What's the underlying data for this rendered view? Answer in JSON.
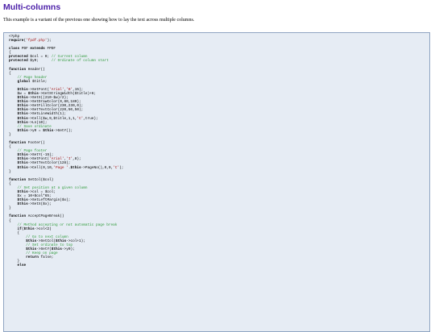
{
  "page": {
    "title": "Multi-columns",
    "intro": "This example is a variant of the previous one showing how to lay the text across multiple columns."
  },
  "code": [
    [
      {
        "t": "<?php",
        "k": "plain"
      }
    ],
    [
      {
        "t": "require",
        "k": "kw"
      },
      {
        "t": "(",
        "k": "plain"
      },
      {
        "t": "'fpdf.php'",
        "k": "str"
      },
      {
        "t": ");",
        "k": "plain"
      }
    ],
    [
      {
        "t": "",
        "k": "plain"
      }
    ],
    [
      {
        "t": "class",
        "k": "kw"
      },
      {
        "t": " PDF ",
        "k": "plain"
      },
      {
        "t": "extends",
        "k": "kw"
      },
      {
        "t": " FPDF",
        "k": "plain"
      }
    ],
    [
      {
        "t": "{",
        "k": "plain"
      }
    ],
    [
      {
        "t": "protected",
        "k": "kw"
      },
      {
        "t": " $col = 0; ",
        "k": "plain"
      },
      {
        "t": "// Current column",
        "k": "cmt"
      }
    ],
    [
      {
        "t": "protected",
        "k": "kw"
      },
      {
        "t": " $y0;      ",
        "k": "plain"
      },
      {
        "t": "// Ordinate of column start",
        "k": "cmt"
      }
    ],
    [
      {
        "t": "",
        "k": "plain"
      }
    ],
    [
      {
        "t": "function",
        "k": "kw"
      },
      {
        "t": " Header()",
        "k": "plain"
      }
    ],
    [
      {
        "t": "{",
        "k": "plain"
      }
    ],
    [
      {
        "t": "    ",
        "k": "plain"
      },
      {
        "t": "// Page header",
        "k": "cmt"
      }
    ],
    [
      {
        "t": "    ",
        "k": "plain"
      },
      {
        "t": "global",
        "k": "kw"
      },
      {
        "t": " $title;",
        "k": "plain"
      }
    ],
    [
      {
        "t": "",
        "k": "plain"
      }
    ],
    [
      {
        "t": "    ",
        "k": "plain"
      },
      {
        "t": "$this",
        "k": "kw"
      },
      {
        "t": "->SetFont(",
        "k": "plain"
      },
      {
        "t": "'Arial'",
        "k": "str"
      },
      {
        "t": ",",
        "k": "plain"
      },
      {
        "t": "'B'",
        "k": "str"
      },
      {
        "t": ",15);",
        "k": "plain"
      }
    ],
    [
      {
        "t": "    $w = ",
        "k": "plain"
      },
      {
        "t": "$this",
        "k": "kw"
      },
      {
        "t": "->GetStringWidth($title)+6;",
        "k": "plain"
      }
    ],
    [
      {
        "t": "    ",
        "k": "plain"
      },
      {
        "t": "$this",
        "k": "kw"
      },
      {
        "t": "->SetX((210-$w)/2);",
        "k": "plain"
      }
    ],
    [
      {
        "t": "    ",
        "k": "plain"
      },
      {
        "t": "$this",
        "k": "kw"
      },
      {
        "t": "->SetDrawColor(0,80,180);",
        "k": "plain"
      }
    ],
    [
      {
        "t": "    ",
        "k": "plain"
      },
      {
        "t": "$this",
        "k": "kw"
      },
      {
        "t": "->SetFillColor(230,230,0);",
        "k": "plain"
      }
    ],
    [
      {
        "t": "    ",
        "k": "plain"
      },
      {
        "t": "$this",
        "k": "kw"
      },
      {
        "t": "->SetTextColor(220,50,50);",
        "k": "plain"
      }
    ],
    [
      {
        "t": "    ",
        "k": "plain"
      },
      {
        "t": "$this",
        "k": "kw"
      },
      {
        "t": "->SetLineWidth(1);",
        "k": "plain"
      }
    ],
    [
      {
        "t": "    ",
        "k": "plain"
      },
      {
        "t": "$this",
        "k": "kw"
      },
      {
        "t": "->Cell($w,9,$title,1,1,",
        "k": "plain"
      },
      {
        "t": "'C'",
        "k": "str"
      },
      {
        "t": ",true);",
        "k": "plain"
      }
    ],
    [
      {
        "t": "    ",
        "k": "plain"
      },
      {
        "t": "$this",
        "k": "kw"
      },
      {
        "t": "->Ln(10);",
        "k": "plain"
      }
    ],
    [
      {
        "t": "    ",
        "k": "plain"
      },
      {
        "t": "// Save ordinate",
        "k": "cmt"
      }
    ],
    [
      {
        "t": "    ",
        "k": "plain"
      },
      {
        "t": "$this",
        "k": "kw"
      },
      {
        "t": "->y0 = ",
        "k": "plain"
      },
      {
        "t": "$this",
        "k": "kw"
      },
      {
        "t": "->GetY();",
        "k": "plain"
      }
    ],
    [
      {
        "t": "}",
        "k": "plain"
      }
    ],
    [
      {
        "t": "",
        "k": "plain"
      }
    ],
    [
      {
        "t": "function",
        "k": "kw"
      },
      {
        "t": " Footer()",
        "k": "plain"
      }
    ],
    [
      {
        "t": "{",
        "k": "plain"
      }
    ],
    [
      {
        "t": "    ",
        "k": "plain"
      },
      {
        "t": "// Page footer",
        "k": "cmt"
      }
    ],
    [
      {
        "t": "    ",
        "k": "plain"
      },
      {
        "t": "$this",
        "k": "kw"
      },
      {
        "t": "->SetY(-15);",
        "k": "plain"
      }
    ],
    [
      {
        "t": "    ",
        "k": "plain"
      },
      {
        "t": "$this",
        "k": "kw"
      },
      {
        "t": "->SetFont(",
        "k": "plain"
      },
      {
        "t": "'Arial'",
        "k": "str"
      },
      {
        "t": ",",
        "k": "plain"
      },
      {
        "t": "'I'",
        "k": "str"
      },
      {
        "t": ",8);",
        "k": "plain"
      }
    ],
    [
      {
        "t": "    ",
        "k": "plain"
      },
      {
        "t": "$this",
        "k": "kw"
      },
      {
        "t": "->SetTextColor(128);",
        "k": "plain"
      }
    ],
    [
      {
        "t": "    ",
        "k": "plain"
      },
      {
        "t": "$this",
        "k": "kw"
      },
      {
        "t": "->Cell(0,10,",
        "k": "plain"
      },
      {
        "t": "'Page '",
        "k": "str"
      },
      {
        "t": ".",
        "k": "plain"
      },
      {
        "t": "$this",
        "k": "kw"
      },
      {
        "t": "->PageNo(),0,0,",
        "k": "plain"
      },
      {
        "t": "'C'",
        "k": "str"
      },
      {
        "t": ");",
        "k": "plain"
      }
    ],
    [
      {
        "t": "}",
        "k": "plain"
      }
    ],
    [
      {
        "t": "",
        "k": "plain"
      }
    ],
    [
      {
        "t": "function",
        "k": "kw"
      },
      {
        "t": " SetCol($col)",
        "k": "plain"
      }
    ],
    [
      {
        "t": "{",
        "k": "plain"
      }
    ],
    [
      {
        "t": "    ",
        "k": "plain"
      },
      {
        "t": "// Set position at a given column",
        "k": "cmt"
      }
    ],
    [
      {
        "t": "    ",
        "k": "plain"
      },
      {
        "t": "$this",
        "k": "kw"
      },
      {
        "t": "->col = $col;",
        "k": "plain"
      }
    ],
    [
      {
        "t": "    $x = 10+$col*65;",
        "k": "plain"
      }
    ],
    [
      {
        "t": "    ",
        "k": "plain"
      },
      {
        "t": "$this",
        "k": "kw"
      },
      {
        "t": "->SetLeftMargin($x);",
        "k": "plain"
      }
    ],
    [
      {
        "t": "    ",
        "k": "plain"
      },
      {
        "t": "$this",
        "k": "kw"
      },
      {
        "t": "->SetX($x);",
        "k": "plain"
      }
    ],
    [
      {
        "t": "}",
        "k": "plain"
      }
    ],
    [
      {
        "t": "",
        "k": "plain"
      }
    ],
    [
      {
        "t": "function",
        "k": "kw"
      },
      {
        "t": " AcceptPageBreak()",
        "k": "plain"
      }
    ],
    [
      {
        "t": "{",
        "k": "plain"
      }
    ],
    [
      {
        "t": "    ",
        "k": "plain"
      },
      {
        "t": "// Method accepting or not automatic page break",
        "k": "cmt"
      }
    ],
    [
      {
        "t": "    ",
        "k": "plain"
      },
      {
        "t": "if",
        "k": "kw"
      },
      {
        "t": "(",
        "k": "plain"
      },
      {
        "t": "$this",
        "k": "kw"
      },
      {
        "t": "->col<2)",
        "k": "plain"
      }
    ],
    [
      {
        "t": "    {",
        "k": "plain"
      }
    ],
    [
      {
        "t": "        ",
        "k": "plain"
      },
      {
        "t": "// Go to next column",
        "k": "cmt"
      }
    ],
    [
      {
        "t": "        ",
        "k": "plain"
      },
      {
        "t": "$this",
        "k": "kw"
      },
      {
        "t": "->SetCol(",
        "k": "plain"
      },
      {
        "t": "$this",
        "k": "kw"
      },
      {
        "t": "->col+1);",
        "k": "plain"
      }
    ],
    [
      {
        "t": "        ",
        "k": "plain"
      },
      {
        "t": "// Set ordinate to top",
        "k": "cmt"
      }
    ],
    [
      {
        "t": "        ",
        "k": "plain"
      },
      {
        "t": "$this",
        "k": "kw"
      },
      {
        "t": "->SetY(",
        "k": "plain"
      },
      {
        "t": "$this",
        "k": "kw"
      },
      {
        "t": "->y0);",
        "k": "plain"
      }
    ],
    [
      {
        "t": "        ",
        "k": "plain"
      },
      {
        "t": "// Keep on page",
        "k": "cmt"
      }
    ],
    [
      {
        "t": "        ",
        "k": "plain"
      },
      {
        "t": "return",
        "k": "kw"
      },
      {
        "t": " false;",
        "k": "plain"
      }
    ],
    [
      {
        "t": "    }",
        "k": "plain"
      }
    ],
    [
      {
        "t": "    ",
        "k": "plain"
      },
      {
        "t": "else",
        "k": "kw"
      }
    ]
  ]
}
